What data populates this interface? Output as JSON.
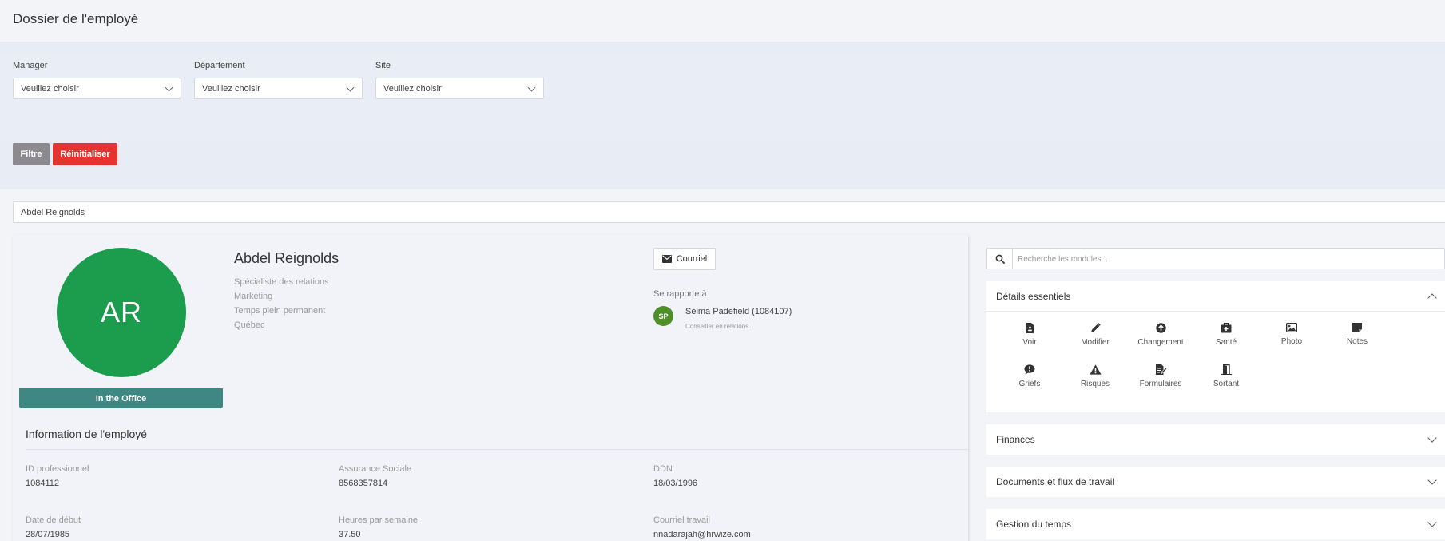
{
  "page": {
    "title": "Dossier de l'employé"
  },
  "filters": {
    "manager": {
      "label": "Manager",
      "value": "Veuillez choisir"
    },
    "department": {
      "label": "Département",
      "value": "Veuillez choisir"
    },
    "site": {
      "label": "Site",
      "value": "Veuillez choisir"
    },
    "filter_label": "Filtre",
    "reset_label": "Réinitialiser"
  },
  "employee_select": {
    "value": "Abdel Reignolds"
  },
  "profile": {
    "initials": "AR",
    "name": "Abdel Reignolds",
    "job_title": "Spécialiste des relations",
    "department": "Marketing",
    "employment_type": "Temps plein permanent",
    "location": "Québec",
    "status": "In the Office",
    "email_label": "Courriel",
    "reports_to_label": "Se rapporte à",
    "manager": {
      "initials": "SP",
      "name": "Selma Padefield (1084107)",
      "role": "Conseiller en relations"
    },
    "avatar_color": "#1c9c4d",
    "status_color": "#3f8782"
  },
  "info": {
    "title": "Information de l'employé",
    "fields": [
      {
        "label": "ID professionnel",
        "value": "1084112"
      },
      {
        "label": "Assurance Sociale",
        "value": "8568357814"
      },
      {
        "label": "DDN",
        "value": "18/03/1996"
      },
      {
        "label": "Date de début",
        "value": "28/07/1985"
      },
      {
        "label": "Heures par semaine",
        "value": "37.50"
      },
      {
        "label": "Courriel travail",
        "value": "nnadarajah@hrwize.com"
      }
    ]
  },
  "modules": {
    "search_placeholder": "Recherche les modules...",
    "essentials": {
      "title": "Détails essentiels",
      "items": [
        {
          "label": "Voir",
          "icon": "document-icon"
        },
        {
          "label": "Modifier",
          "icon": "pencil-icon"
        },
        {
          "label": "Changement",
          "icon": "arrow-up-circle-icon"
        },
        {
          "label": "Santé",
          "icon": "medical-kit-icon"
        },
        {
          "label": "Photo",
          "icon": "image-icon"
        },
        {
          "label": "Notes",
          "icon": "sticky-note-icon"
        },
        {
          "label": "Griefs",
          "icon": "comment-exclamation-icon"
        },
        {
          "label": "Risques",
          "icon": "warning-triangle-icon"
        },
        {
          "label": "Formulaires",
          "icon": "form-edit-icon"
        },
        {
          "label": "Sortant",
          "icon": "door-exit-icon"
        }
      ]
    },
    "panels": [
      {
        "title": "Finances"
      },
      {
        "title": "Documents et flux de travail"
      },
      {
        "title": "Gestion du temps"
      }
    ]
  }
}
